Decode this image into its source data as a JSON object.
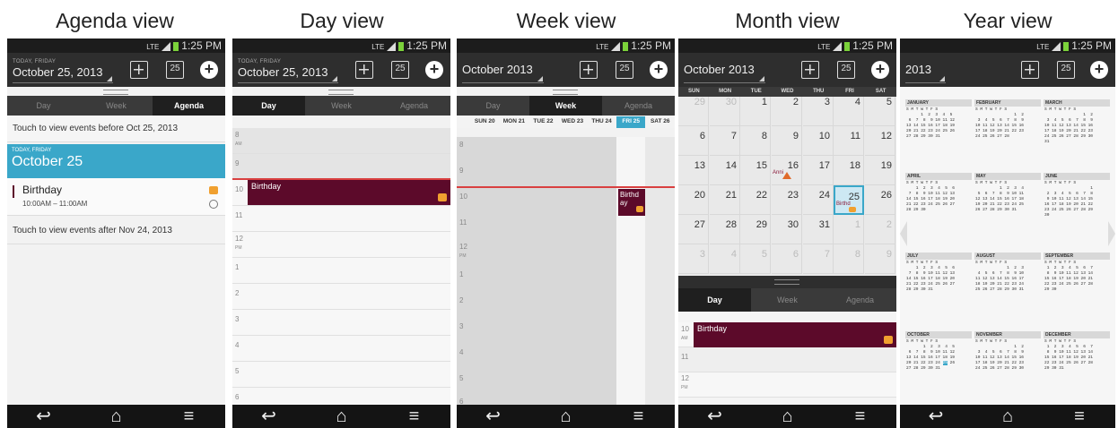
{
  "captions": [
    "Agenda view",
    "Day view",
    "Week view",
    "Month view",
    "Year view"
  ],
  "status": {
    "network": "LTE",
    "time": "1:25 PM"
  },
  "header": {
    "today_label": "TODAY, FRIDAY",
    "date_full": "October 25, 2013",
    "month_year": "October 2013",
    "year": "2013",
    "cal_icon_day": "25"
  },
  "tabs": [
    "Day",
    "Week",
    "Agenda"
  ],
  "agenda": {
    "before": "Touch to view events before Oct 25, 2013",
    "today_label": "TODAY, FRIDAY",
    "today_date": "October 25",
    "event_title": "Birthday",
    "event_time": "10:00AM – 11:00AM",
    "after": "Touch to view events after Nov 24, 2013"
  },
  "day": {
    "hours": [
      "8",
      "9",
      "10",
      "11",
      "12",
      "1",
      "2",
      "3",
      "4",
      "5",
      "6"
    ],
    "am": "AM",
    "pm": "PM",
    "event": "Birthday"
  },
  "week": {
    "days": [
      "SUN 20",
      "MON 21",
      "TUE 22",
      "WED 23",
      "THU 24",
      "FRI 25",
      "SAT 26"
    ],
    "hours": [
      "8",
      "9",
      "10",
      "11",
      "12",
      "1",
      "2",
      "3",
      "4",
      "5",
      "6"
    ],
    "pm": "PM",
    "event_a": "Birthd",
    "event_b": "ay"
  },
  "month": {
    "dow": [
      "SUN",
      "MON",
      "TUE",
      "WED",
      "THU",
      "FRI",
      "SAT"
    ],
    "weeks": [
      [
        "29",
        "30",
        "1",
        "2",
        "3",
        "4",
        "5"
      ],
      [
        "6",
        "7",
        "8",
        "9",
        "10",
        "11",
        "12"
      ],
      [
        "13",
        "14",
        "15",
        "16",
        "17",
        "18",
        "19"
      ],
      [
        "20",
        "21",
        "22",
        "23",
        "24",
        "25",
        "26"
      ],
      [
        "27",
        "28",
        "29",
        "30",
        "31",
        "1",
        "2"
      ],
      [
        "3",
        "4",
        "5",
        "6",
        "7",
        "8",
        "9"
      ]
    ],
    "anni": "Anni",
    "bday": "Birthd",
    "hour10": "10",
    "am": "AM",
    "hour11": "11",
    "hour12": "12",
    "pm": "PM",
    "event": "Birthday"
  },
  "year": {
    "months": [
      "JANUARY",
      "FEBRUARY",
      "MARCH",
      "APRIL",
      "MAY",
      "JUNE",
      "JULY",
      "AUGUST",
      "SEPTEMBER",
      "OCTOBER",
      "NOVEMBER",
      "DECEMBER"
    ],
    "dow": "S M T W T F S"
  },
  "colors": {
    "accent": "#3aa7c9",
    "event": "#5c0a2a",
    "nowline": "#d94040"
  }
}
